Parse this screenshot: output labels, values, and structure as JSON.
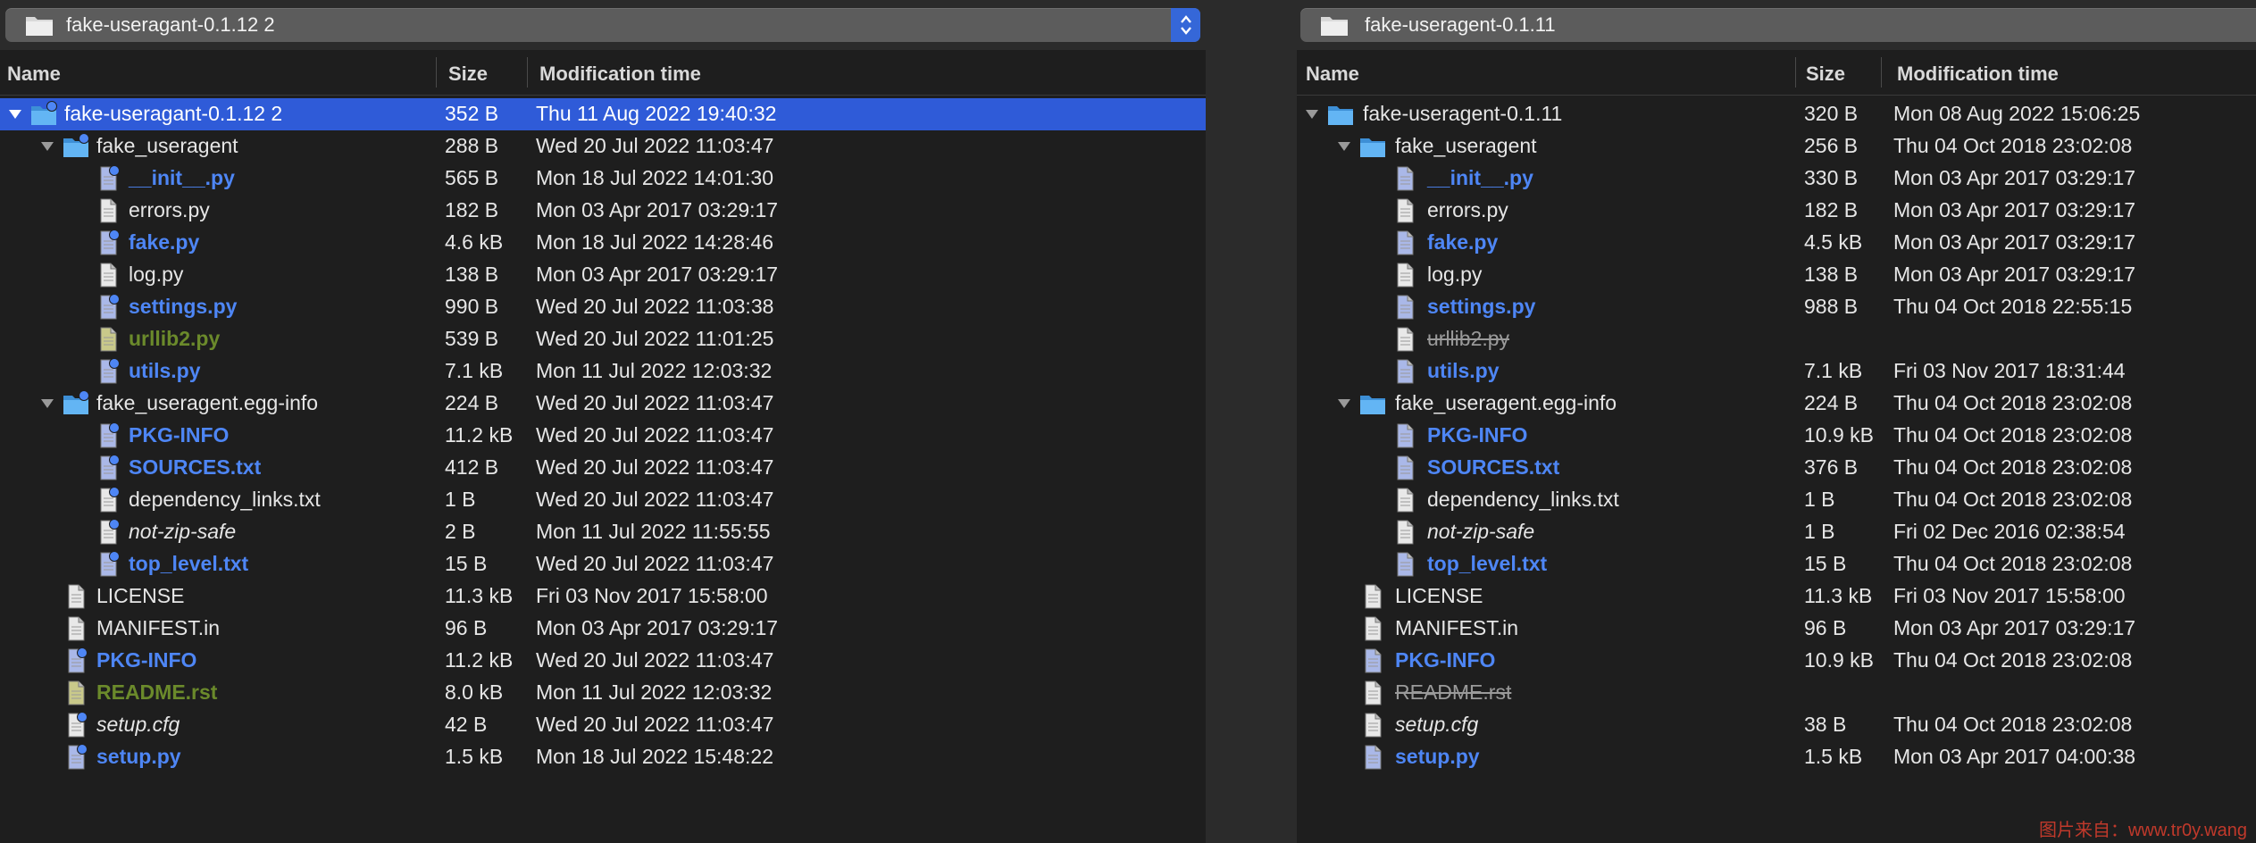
{
  "colors": {
    "background": "#1e1e1e",
    "selection": "#2f5bd8",
    "modified": "#4e86f5",
    "newer": "#6b8a2b",
    "absent": "#9a9a9a",
    "folder": "#5db2f2"
  },
  "left": {
    "path": "fake-useragant-0.1.12 2",
    "columns": {
      "name": "Name",
      "size": "Size",
      "time": "Modification time"
    },
    "rows": [
      {
        "depth": 0,
        "kind": "folder",
        "expanded": true,
        "name": "fake-useragant-0.1.12 2",
        "size": "352 B",
        "time": "Thu 11 Aug 2022 19:40:32",
        "style": "normal",
        "selected": true,
        "dot": true
      },
      {
        "depth": 1,
        "kind": "folder",
        "expanded": true,
        "name": "fake_useragent",
        "size": "288 B",
        "time": "Wed 20 Jul 2022 11:03:47",
        "style": "normal",
        "dot": true
      },
      {
        "depth": 2,
        "kind": "file",
        "name": "__init__.py",
        "size": "565 B",
        "time": "Mon 18 Jul 2022 14:01:30",
        "style": "modified",
        "dot": true
      },
      {
        "depth": 2,
        "kind": "file",
        "name": "errors.py",
        "size": "182 B",
        "time": "Mon 03 Apr 2017 03:29:17",
        "style": "normal"
      },
      {
        "depth": 2,
        "kind": "file",
        "name": "fake.py",
        "size": "4.6 kB",
        "time": "Mon 18 Jul 2022 14:28:46",
        "style": "modified",
        "dot": true
      },
      {
        "depth": 2,
        "kind": "file",
        "name": "log.py",
        "size": "138 B",
        "time": "Mon 03 Apr 2017 03:29:17",
        "style": "normal"
      },
      {
        "depth": 2,
        "kind": "file",
        "name": "settings.py",
        "size": "990 B",
        "time": "Wed 20 Jul 2022 11:03:38",
        "style": "modified",
        "dot": true
      },
      {
        "depth": 2,
        "kind": "file",
        "name": "urllib2.py",
        "size": "539 B",
        "time": "Wed 20 Jul 2022 11:01:25",
        "style": "newer"
      },
      {
        "depth": 2,
        "kind": "file",
        "name": "utils.py",
        "size": "7.1 kB",
        "time": "Mon 11 Jul 2022 12:03:32",
        "style": "modified",
        "dot": true
      },
      {
        "depth": 1,
        "kind": "folder",
        "expanded": true,
        "name": "fake_useragent.egg-info",
        "size": "224 B",
        "time": "Wed 20 Jul 2022 11:03:47",
        "style": "normal",
        "dot": true
      },
      {
        "depth": 2,
        "kind": "file",
        "name": "PKG-INFO",
        "size": "11.2 kB",
        "time": "Wed 20 Jul 2022 11:03:47",
        "style": "modified",
        "dot": true
      },
      {
        "depth": 2,
        "kind": "file",
        "name": "SOURCES.txt",
        "size": "412 B",
        "time": "Wed 20 Jul 2022 11:03:47",
        "style": "modified",
        "dot": true
      },
      {
        "depth": 2,
        "kind": "file",
        "name": "dependency_links.txt",
        "size": "1 B",
        "time": "Wed 20 Jul 2022 11:03:47",
        "style": "normal",
        "dot": true
      },
      {
        "depth": 2,
        "kind": "file",
        "name": "not-zip-safe",
        "size": "2 B",
        "time": "Mon 11 Jul 2022 11:55:55",
        "style": "italic",
        "dot": true
      },
      {
        "depth": 2,
        "kind": "file",
        "name": "top_level.txt",
        "size": "15 B",
        "time": "Wed 20 Jul 2022 11:03:47",
        "style": "modified",
        "dot": true
      },
      {
        "depth": 1,
        "kind": "file",
        "name": "LICENSE",
        "size": "11.3 kB",
        "time": "Fri 03 Nov 2017 15:58:00",
        "style": "normal"
      },
      {
        "depth": 1,
        "kind": "file",
        "name": "MANIFEST.in",
        "size": "96 B",
        "time": "Mon 03 Apr 2017 03:29:17",
        "style": "normal"
      },
      {
        "depth": 1,
        "kind": "file",
        "name": "PKG-INFO",
        "size": "11.2 kB",
        "time": "Wed 20 Jul 2022 11:03:47",
        "style": "modified",
        "dot": true
      },
      {
        "depth": 1,
        "kind": "file",
        "name": "README.rst",
        "size": "8.0 kB",
        "time": "Mon 11 Jul 2022 12:03:32",
        "style": "newer"
      },
      {
        "depth": 1,
        "kind": "file",
        "name": "setup.cfg",
        "size": "42 B",
        "time": "Wed 20 Jul 2022 11:03:47",
        "style": "italic",
        "dot": true
      },
      {
        "depth": 1,
        "kind": "file",
        "name": "setup.py",
        "size": "1.5 kB",
        "time": "Mon 18 Jul 2022 15:48:22",
        "style": "modified",
        "dot": true
      }
    ]
  },
  "right": {
    "path": "fake-useragent-0.1.11",
    "columns": {
      "name": "Name",
      "size": "Size",
      "time": "Modification time"
    },
    "rows": [
      {
        "depth": 0,
        "kind": "folder",
        "expanded": true,
        "name": "fake-useragent-0.1.11",
        "size": "320 B",
        "time": "Mon 08 Aug 2022 15:06:25",
        "style": "normal"
      },
      {
        "depth": 1,
        "kind": "folder",
        "expanded": true,
        "name": "fake_useragent",
        "size": "256 B",
        "time": "Thu 04 Oct 2018 23:02:08",
        "style": "normal"
      },
      {
        "depth": 2,
        "kind": "file",
        "name": "__init__.py",
        "size": "330 B",
        "time": "Mon 03 Apr 2017 03:29:17",
        "style": "modified"
      },
      {
        "depth": 2,
        "kind": "file",
        "name": "errors.py",
        "size": "182 B",
        "time": "Mon 03 Apr 2017 03:29:17",
        "style": "normal"
      },
      {
        "depth": 2,
        "kind": "file",
        "name": "fake.py",
        "size": "4.5 kB",
        "time": "Mon 03 Apr 2017 03:29:17",
        "style": "modified"
      },
      {
        "depth": 2,
        "kind": "file",
        "name": "log.py",
        "size": "138 B",
        "time": "Mon 03 Apr 2017 03:29:17",
        "style": "normal"
      },
      {
        "depth": 2,
        "kind": "file",
        "name": "settings.py",
        "size": "988 B",
        "time": "Thu 04 Oct 2018 22:55:15",
        "style": "modified"
      },
      {
        "depth": 2,
        "kind": "file",
        "name": "urllib2.py",
        "size": "",
        "time": "",
        "style": "absent"
      },
      {
        "depth": 2,
        "kind": "file",
        "name": "utils.py",
        "size": "7.1 kB",
        "time": "Fri 03 Nov 2017 18:31:44",
        "style": "modified"
      },
      {
        "depth": 1,
        "kind": "folder",
        "expanded": true,
        "name": "fake_useragent.egg-info",
        "size": "224 B",
        "time": "Thu 04 Oct 2018 23:02:08",
        "style": "normal"
      },
      {
        "depth": 2,
        "kind": "file",
        "name": "PKG-INFO",
        "size": "10.9 kB",
        "time": "Thu 04 Oct 2018 23:02:08",
        "style": "modified"
      },
      {
        "depth": 2,
        "kind": "file",
        "name": "SOURCES.txt",
        "size": "376 B",
        "time": "Thu 04 Oct 2018 23:02:08",
        "style": "modified"
      },
      {
        "depth": 2,
        "kind": "file",
        "name": "dependency_links.txt",
        "size": "1 B",
        "time": "Thu 04 Oct 2018 23:02:08",
        "style": "normal"
      },
      {
        "depth": 2,
        "kind": "file",
        "name": "not-zip-safe",
        "size": "1 B",
        "time": "Fri 02 Dec 2016 02:38:54",
        "style": "italic"
      },
      {
        "depth": 2,
        "kind": "file",
        "name": "top_level.txt",
        "size": "15 B",
        "time": "Thu 04 Oct 2018 23:02:08",
        "style": "modified"
      },
      {
        "depth": 1,
        "kind": "file",
        "name": "LICENSE",
        "size": "11.3 kB",
        "time": "Fri 03 Nov 2017 15:58:00",
        "style": "normal"
      },
      {
        "depth": 1,
        "kind": "file",
        "name": "MANIFEST.in",
        "size": "96 B",
        "time": "Mon 03 Apr 2017 03:29:17",
        "style": "normal"
      },
      {
        "depth": 1,
        "kind": "file",
        "name": "PKG-INFO",
        "size": "10.9 kB",
        "time": "Thu 04 Oct 2018 23:02:08",
        "style": "modified"
      },
      {
        "depth": 1,
        "kind": "file",
        "name": "README.rst",
        "size": "",
        "time": "",
        "style": "absent"
      },
      {
        "depth": 1,
        "kind": "file",
        "name": "setup.cfg",
        "size": "38 B",
        "time": "Thu 04 Oct 2018 23:02:08",
        "style": "italic"
      },
      {
        "depth": 1,
        "kind": "file",
        "name": "setup.py",
        "size": "1.5 kB",
        "time": "Mon 03 Apr 2017 04:00:38",
        "style": "modified"
      }
    ]
  },
  "watermark": "图片来自：www.tr0y.wang"
}
